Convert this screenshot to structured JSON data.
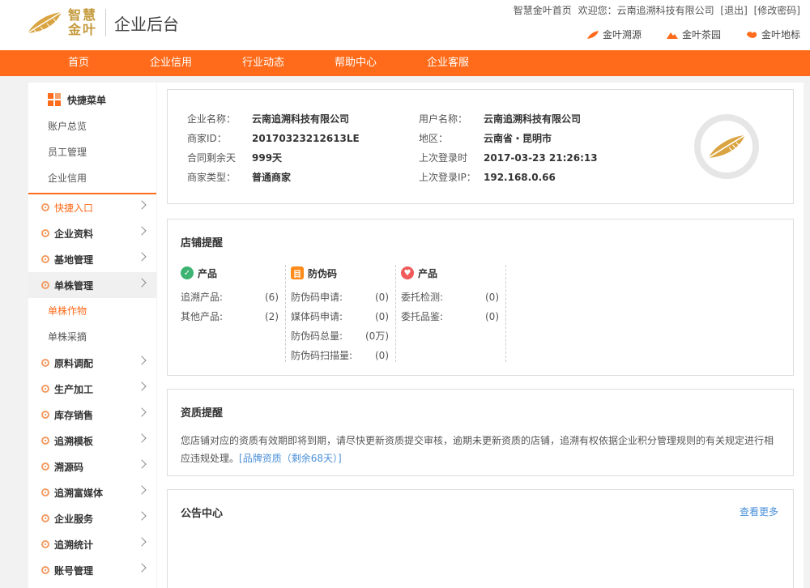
{
  "header": {
    "logo_line1": "智慧",
    "logo_line2": "金叶",
    "subtitle": "企业后台",
    "home_link": "智慧金叶首页",
    "welcome": "欢迎您：云南追溯科技有限公司",
    "logout": "[退出]",
    "change_pwd": "[修改密码]",
    "sublinks": [
      {
        "label": "金叶溯源",
        "icon": "leaf-icon"
      },
      {
        "label": "金叶茶园",
        "icon": "mountain-icon"
      },
      {
        "label": "金叶地标",
        "icon": "map-icon"
      }
    ]
  },
  "nav": [
    "首页",
    "企业信用",
    "行业动态",
    "帮助中心",
    "企业客服"
  ],
  "sidebar": {
    "quick_title": "快捷菜单",
    "quick_links": [
      "账户总览",
      "员工管理",
      "企业信用"
    ],
    "menu": [
      {
        "label": "快捷入口",
        "type": "quick-entry"
      },
      {
        "label": "企业资料"
      },
      {
        "label": "基地管理"
      },
      {
        "label": "单株管理",
        "active": true
      },
      {
        "label": "单株作物",
        "sub": true,
        "on": true
      },
      {
        "label": "单株采摘",
        "sub": true
      },
      {
        "label": "原料调配"
      },
      {
        "label": "生产加工"
      },
      {
        "label": "库存销售"
      },
      {
        "label": "追溯模板"
      },
      {
        "label": "溯源码"
      },
      {
        "label": "追溯富媒体"
      },
      {
        "label": "企业服务"
      },
      {
        "label": "追溯统计"
      },
      {
        "label": "账号管理"
      }
    ]
  },
  "info": {
    "rows": [
      {
        "k": "企业名称：",
        "v": "云南追溯科技有限公司",
        "k2": "用户名称：",
        "v2": "云南追溯科技有限公司"
      },
      {
        "k": "商家ID：",
        "v": "20170323212613LE",
        "k2": "地区：",
        "v2": "云南省・昆明市"
      },
      {
        "k": "合同剩余天",
        "v": "999天",
        "k2": "上次登录时",
        "v2": "2017-03-23 21:26:13"
      },
      {
        "k": "商家类型：",
        "v": "普通商家",
        "k2": "上次登录IP：",
        "v2": "192.168.0.66"
      }
    ]
  },
  "shop": {
    "title": "店铺提醒",
    "cols": [
      {
        "title": "产品",
        "icon_color": "#3cb371",
        "lines": [
          [
            "追溯产品:",
            "(6)"
          ],
          [
            "其他产品:",
            "(2)"
          ]
        ]
      },
      {
        "title": "防伪码",
        "icon_color": "#ff8c1a",
        "lines": [
          [
            "防伪码申请:",
            "(0)"
          ],
          [
            "媒体码申请:",
            "(0)"
          ],
          [
            "防伪码总量:",
            "(0万)"
          ],
          [
            "防伪码扫描量:",
            "(0)"
          ]
        ]
      },
      {
        "title": "产品",
        "icon_color": "#f05a5a",
        "lines": [
          [
            "委托检测:",
            "(0)"
          ],
          [
            "委托品鉴:",
            "(0)"
          ]
        ]
      }
    ]
  },
  "qual": {
    "title": "资质提醒",
    "text": "您店铺对应的资质有效期即将到期，请尽快更新资质提交审核，逾期未更新资质的店铺，追溯有权依据企业积分管理规则的有关规定进行相应违规处理。",
    "link": "[品牌资质（剩余68天）]"
  },
  "notice": {
    "title": "公告中心",
    "more": "查看更多"
  }
}
